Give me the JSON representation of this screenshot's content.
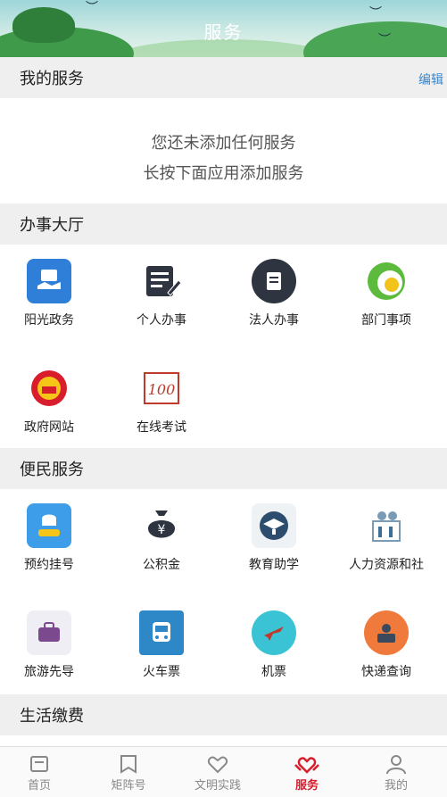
{
  "header": {
    "title": "服务"
  },
  "my_services": {
    "title": "我的服务",
    "edit_label": "编辑",
    "empty_line1": "您还未添加任何服务",
    "empty_line2": "长按下面应用添加服务"
  },
  "hall": {
    "title": "办事大厅",
    "items": [
      {
        "label": "阳光政务",
        "icon": "sunshine-gov-icon"
      },
      {
        "label": "个人办事",
        "icon": "personal-affairs-icon"
      },
      {
        "label": "法人办事",
        "icon": "corporate-affairs-icon"
      },
      {
        "label": "部门事项",
        "icon": "department-matters-icon"
      },
      {
        "label": "政府网站",
        "icon": "gov-website-icon"
      },
      {
        "label": "在线考试",
        "icon": "online-exam-icon"
      }
    ]
  },
  "convenience": {
    "title": "便民服务",
    "items": [
      {
        "label": "预约挂号",
        "icon": "appointment-icon"
      },
      {
        "label": "公积金",
        "icon": "housing-fund-icon"
      },
      {
        "label": "教育助学",
        "icon": "education-icon"
      },
      {
        "label": "人力资源和社",
        "icon": "hr-social-icon"
      },
      {
        "label": "旅游先导",
        "icon": "travel-icon"
      },
      {
        "label": "火车票",
        "icon": "train-ticket-icon"
      },
      {
        "label": "机票",
        "icon": "air-ticket-icon"
      },
      {
        "label": "快递查询",
        "icon": "express-query-icon"
      }
    ]
  },
  "life": {
    "title": "生活缴费"
  },
  "tabbar": {
    "items": [
      {
        "label": "首页",
        "icon": "home-icon"
      },
      {
        "label": "矩阵号",
        "icon": "matrix-icon"
      },
      {
        "label": "文明实践",
        "icon": "heart-icon"
      },
      {
        "label": "服务",
        "icon": "service-icon",
        "active": true
      },
      {
        "label": "我的",
        "icon": "profile-icon"
      }
    ]
  },
  "colors": {
    "accent": "#d81e2c",
    "link": "#3a86c8",
    "section_bg": "#efefef"
  }
}
